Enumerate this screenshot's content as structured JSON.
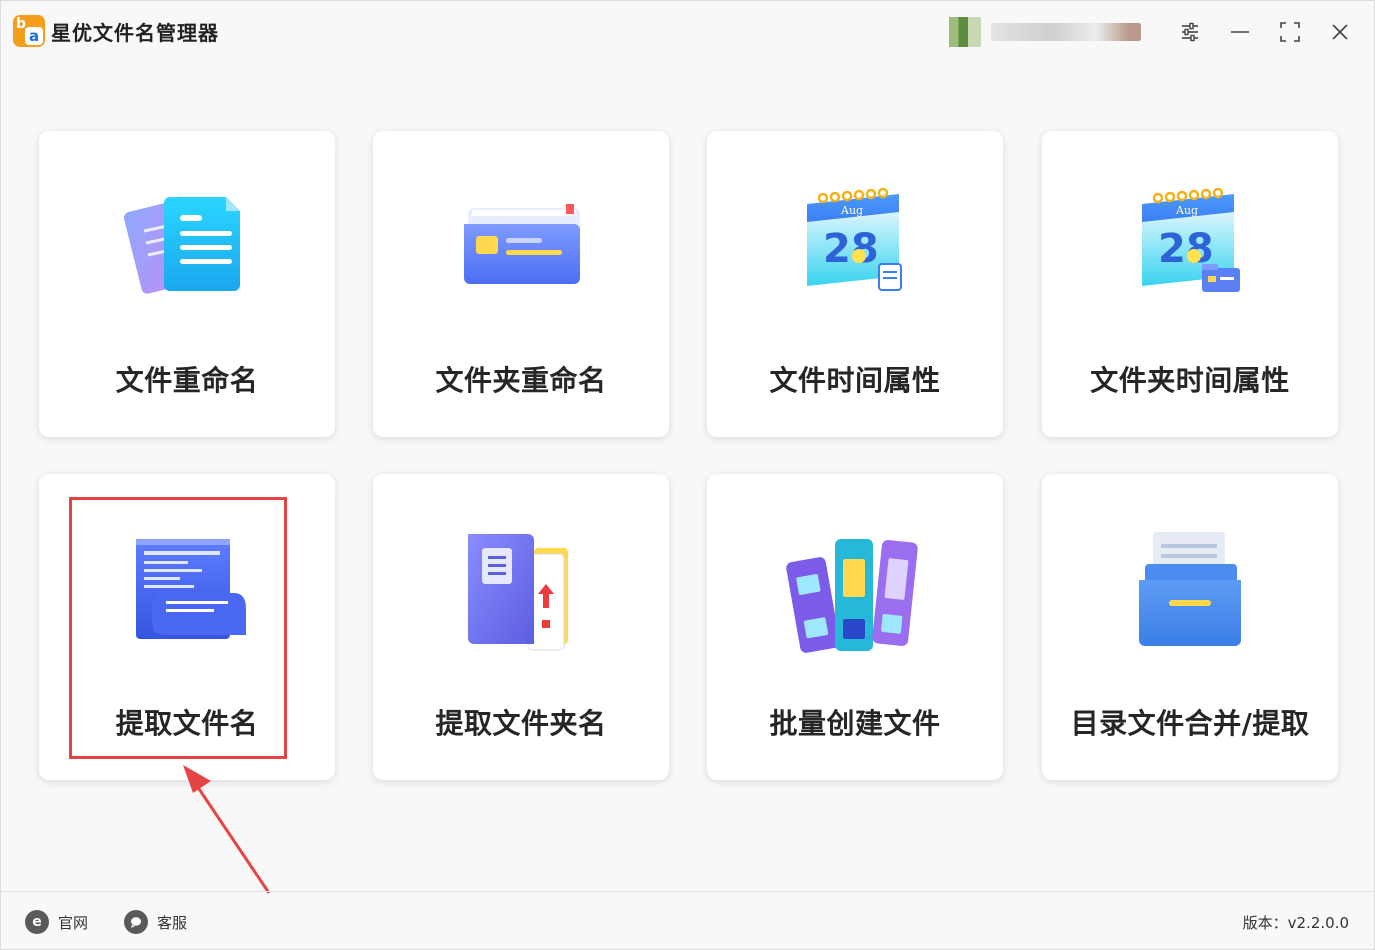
{
  "app": {
    "title": "星优文件名管理器"
  },
  "cards": [
    {
      "label": "文件重命名",
      "icon": "document-stack-icon"
    },
    {
      "label": "文件夹重命名",
      "icon": "folder-card-icon"
    },
    {
      "label": "文件时间属性",
      "icon": "calendar-file-icon"
    },
    {
      "label": "文件夹时间属性",
      "icon": "calendar-folder-icon"
    },
    {
      "label": "提取文件名",
      "icon": "document-scroll-icon"
    },
    {
      "label": "提取文件夹名",
      "icon": "folder-upload-icon"
    },
    {
      "label": "批量创建文件",
      "icon": "binders-icon"
    },
    {
      "label": "目录文件合并/提取",
      "icon": "file-drawer-icon"
    }
  ],
  "calendar": {
    "month": "Aug",
    "day": "28"
  },
  "footer": {
    "website_label": "官网",
    "support_label": "客服",
    "version": "版本：v2.2.0.0"
  },
  "colors": {
    "highlight": "#e54444",
    "accent_blue": "#4d7bf3",
    "accent_cyan": "#19c3ee"
  }
}
